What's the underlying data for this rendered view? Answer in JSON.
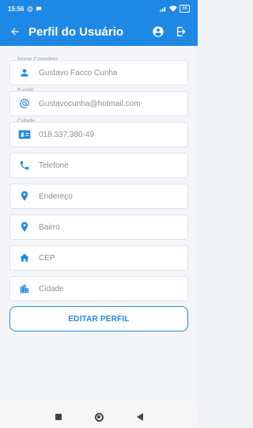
{
  "status": {
    "time": "15:56",
    "battery": "86"
  },
  "appbar": {
    "title": "Perfil do Usuário"
  },
  "fields": [
    {
      "label": "Nome Completo",
      "value": "Gustavo Facco Cunha",
      "icon": "person-icon"
    },
    {
      "label": "E-mail",
      "value": "Gustavocunha@hotmail.com",
      "icon": "at-icon"
    },
    {
      "label": "Cidade",
      "value": "018.337.380-49",
      "icon": "id-card-icon"
    },
    {
      "label": "",
      "value": "Telefone",
      "icon": "phone-icon"
    },
    {
      "label": "",
      "value": "Endereço",
      "icon": "location-pin-icon"
    },
    {
      "label": "",
      "value": "Bairro",
      "icon": "location-pin-icon"
    },
    {
      "label": "",
      "value": "CEP",
      "icon": "home-icon"
    },
    {
      "label": "",
      "value": "Cidade",
      "icon": "city-icon"
    }
  ],
  "button": {
    "label": "EDITAR PERFIL"
  },
  "colors": {
    "primary": "#1e88e5",
    "background": "#f3f5f8"
  }
}
